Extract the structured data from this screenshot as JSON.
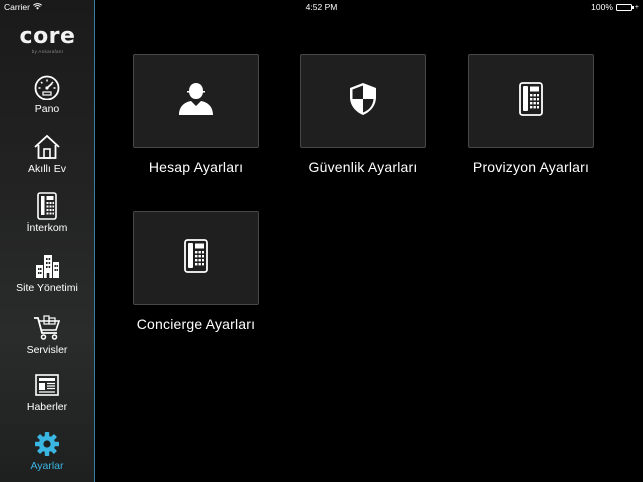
{
  "status_bar": {
    "carrier": "Carrier",
    "time": "4:52 PM",
    "battery": "100%",
    "battery_color": "#4cd964"
  },
  "sidebar": {
    "logo_text": "core",
    "logo_subtext": "by Ankarafant",
    "accent_color": "#3ab6e3",
    "items": [
      {
        "label": "Pano",
        "icon": "dashboard-gauge-icon"
      },
      {
        "label": "Akıllı Ev",
        "icon": "home-icon"
      },
      {
        "label": "İnterkom",
        "icon": "intercom-phone-icon"
      },
      {
        "label": "Site Yönetimi",
        "icon": "buildings-icon"
      },
      {
        "label": "Servisler",
        "icon": "shopping-cart-icon"
      },
      {
        "label": "Haberler",
        "icon": "newspaper-icon"
      },
      {
        "label": "Ayarlar",
        "icon": "gear-icon",
        "active": true
      }
    ]
  },
  "main": {
    "tiles": [
      {
        "label": "Hesap Ayarları",
        "icon": "user-icon"
      },
      {
        "label": "Güvenlik Ayarları",
        "icon": "shield-icon"
      },
      {
        "label": "Provizyon Ayarları",
        "icon": "desk-phone-icon"
      },
      {
        "label": "Concierge Ayarları",
        "icon": "desk-phone-icon"
      }
    ]
  }
}
